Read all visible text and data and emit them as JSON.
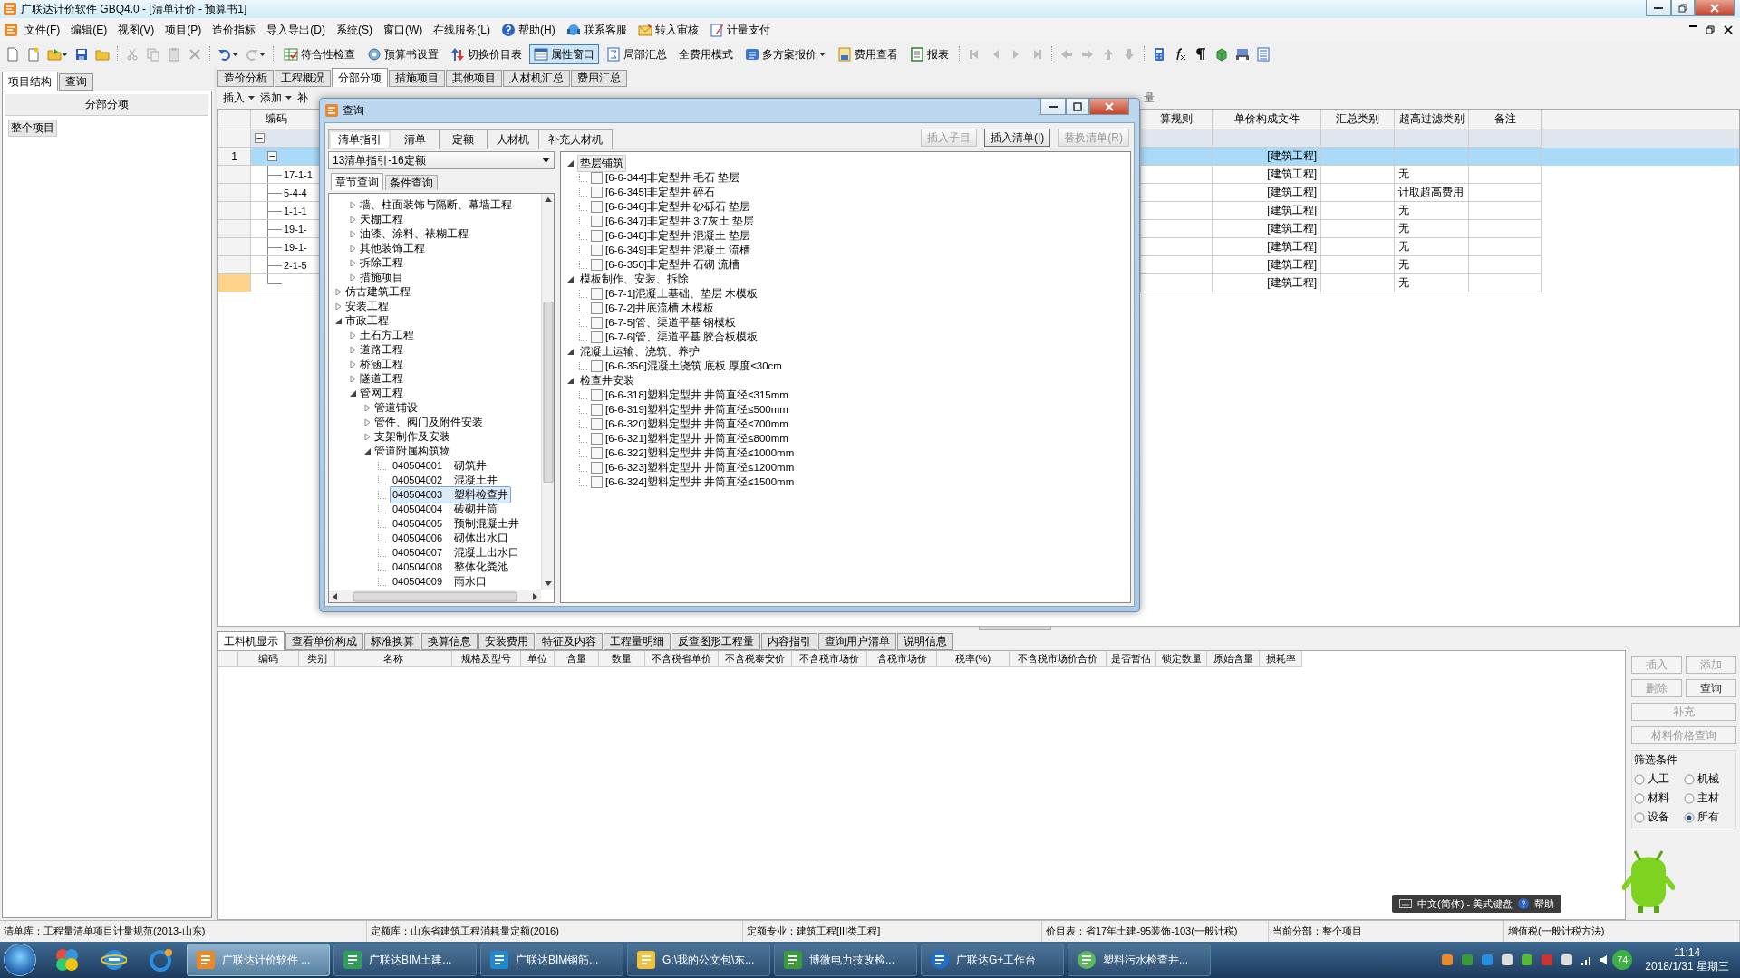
{
  "window": {
    "title": "广联达计价软件 GBQ4.0 - [清单计价 - 预算书1]"
  },
  "menu": [
    {
      "label": "文件(F)",
      "kind": "plain"
    },
    {
      "label": "编辑(E)",
      "kind": "plain"
    },
    {
      "label": "视图(V)",
      "kind": "plain"
    },
    {
      "label": "项目(P)",
      "kind": "plain"
    },
    {
      "label": "造价指标",
      "kind": "plain"
    },
    {
      "label": "导入导出(D)",
      "kind": "plain"
    },
    {
      "label": "系统(S)",
      "kind": "plain"
    },
    {
      "label": "窗口(W)",
      "kind": "plain"
    },
    {
      "label": "在线服务(L)",
      "kind": "plain"
    },
    {
      "label": "帮助(H)",
      "kind": "help"
    },
    {
      "label": "联系客服",
      "kind": "service"
    },
    {
      "label": "转入审核",
      "kind": "review"
    },
    {
      "label": "计量支付",
      "kind": "payment"
    }
  ],
  "toolbar": [
    {
      "label": "符合性检查",
      "kind": "check",
      "pressed": false,
      "dropdown": false
    },
    {
      "label": "预算书设置",
      "kind": "gear",
      "pressed": false,
      "dropdown": false
    },
    {
      "label": "切换价目表",
      "kind": "swap",
      "pressed": false,
      "dropdown": false
    },
    {
      "label": "属性窗口",
      "kind": "window",
      "pressed": true,
      "dropdown": false
    },
    {
      "label": "局部汇总",
      "kind": "sum",
      "pressed": false,
      "dropdown": false
    },
    {
      "label": "全费用模式",
      "kind": "plain",
      "pressed": false,
      "dropdown": false
    },
    {
      "label": "多方案报价",
      "kind": "multi",
      "pressed": false,
      "dropdown": true
    },
    {
      "label": "费用查看",
      "kind": "money",
      "pressed": false,
      "dropdown": false
    },
    {
      "label": "报表",
      "kind": "report",
      "pressed": false,
      "dropdown": false
    }
  ],
  "left_panel": {
    "tabs": [
      {
        "label": "项目结构",
        "selected": true
      },
      {
        "label": "查询",
        "selected": false
      }
    ],
    "header": "分部分项",
    "items": [
      {
        "label": "整个项目",
        "selected": true
      }
    ]
  },
  "doc_tabs": [
    {
      "label": "造价分析",
      "selected": false
    },
    {
      "label": "工程概况",
      "selected": false
    },
    {
      "label": "分部分项",
      "selected": true
    },
    {
      "label": "措施项目",
      "selected": false
    },
    {
      "label": "其他项目",
      "selected": false
    },
    {
      "label": "人材机汇总",
      "selected": false
    },
    {
      "label": "费用汇总",
      "selected": false
    }
  ],
  "sub_toolbar": [
    {
      "label": "插入",
      "dropdown": true
    },
    {
      "label": "添加",
      "dropdown": true
    },
    {
      "label": "补",
      "dropdown": false
    }
  ],
  "sub_toolbar_right": "量",
  "main_grid": {
    "columns": [
      "编码",
      "算规则",
      "单价构成文件",
      "汇总类别",
      "超高过滤类别",
      "备注"
    ],
    "rows": [
      {
        "kind": "filter",
        "expanded": true,
        "selected": false,
        "current": false
      },
      {
        "kind": "section",
        "number": "1",
        "expanded": true,
        "selected": true,
        "current": false,
        "unit_file": "[建筑工程]"
      },
      {
        "kind": "item",
        "code": "17-1-1",
        "selected": false,
        "current": false,
        "unit_file": "[建筑工程]",
        "height_filter": "无"
      },
      {
        "kind": "item",
        "code": "5-4-4",
        "selected": false,
        "current": false,
        "unit_file": "[建筑工程]",
        "height_filter": "计取超高费用"
      },
      {
        "kind": "item",
        "code": "1-1-1",
        "selected": false,
        "current": false,
        "unit_file": "[建筑工程]",
        "height_filter": "无"
      },
      {
        "kind": "item",
        "code": "19-1-",
        "selected": false,
        "current": false,
        "unit_file": "[建筑工程]",
        "height_filter": "无"
      },
      {
        "kind": "item",
        "code": "19-1-",
        "selected": false,
        "current": false,
        "unit_file": "[建筑工程]",
        "height_filter": "无"
      },
      {
        "kind": "item",
        "code": "2-1-5",
        "selected": false,
        "current": false,
        "unit_file": "[建筑工程]",
        "height_filter": "无"
      },
      {
        "kind": "item",
        "selected": false,
        "current": true,
        "unit_file": "[建筑工程]",
        "height_filter": "无"
      }
    ]
  },
  "dialog": {
    "title": "查询",
    "tabs": [
      {
        "label": "清单指引",
        "selected": true
      },
      {
        "label": "清单",
        "selected": false
      },
      {
        "label": "定额",
        "selected": false
      },
      {
        "label": "人材机",
        "selected": false
      },
      {
        "label": "补充人材机",
        "selected": false
      }
    ],
    "buttons": [
      {
        "label": "插入子目",
        "disabled": true
      },
      {
        "label": "插入清单(I)",
        "disabled": false
      },
      {
        "label": "替换清单(R)",
        "disabled": true
      }
    ],
    "library": "13清单指引-16定额",
    "query_tabs": [
      {
        "label": "章节查询",
        "selected": true
      },
      {
        "label": "条件查询",
        "selected": false
      }
    ],
    "chapter_tree": [
      {
        "children": [
          {
            "label": "墙、柱面装饰与隔断、幕墙工程",
            "expanded": false
          },
          {
            "label": "天棚工程",
            "expanded": false
          },
          {
            "label": "油漆、涂料、裱糊工程",
            "expanded": false
          },
          {
            "label": "其他装饰工程",
            "expanded": false
          },
          {
            "label": "拆除工程",
            "expanded": false
          },
          {
            "label": "措施项目",
            "expanded": false
          }
        ]
      },
      {
        "label": "仿古建筑工程",
        "expanded": false
      },
      {
        "label": "安装工程",
        "expanded": false
      },
      {
        "label": "市政工程",
        "expanded": true,
        "children": [
          {
            "label": "土石方工程",
            "expanded": false
          },
          {
            "label": "道路工程",
            "expanded": false
          },
          {
            "label": "桥涵工程",
            "expanded": false
          },
          {
            "label": "隧道工程",
            "expanded": false
          },
          {
            "label": "管网工程",
            "expanded": true,
            "children": [
              {
                "label": "管道铺设",
                "expanded": false
              },
              {
                "label": "管件、阀门及附件安装",
                "expanded": false
              },
              {
                "label": "支架制作及安装",
                "expanded": false
              },
              {
                "label": "管道附属构筑物",
                "expanded": true,
                "children": [
                  {
                    "code": "040504001",
                    "label": "砌筑井",
                    "selected": false
                  },
                  {
                    "code": "040504002",
                    "label": "混凝土井",
                    "selected": false
                  },
                  {
                    "code": "040504003",
                    "label": "塑料检查井",
                    "selected": true
                  },
                  {
                    "code": "040504004",
                    "label": "砖砌井筒",
                    "selected": false
                  },
                  {
                    "code": "040504005",
                    "label": "预制混凝土井",
                    "selected": false
                  },
                  {
                    "code": "040504006",
                    "label": "砌体出水口",
                    "selected": false
                  },
                  {
                    "code": "040504007",
                    "label": "混凝土出水口",
                    "selected": false
                  },
                  {
                    "code": "040504008",
                    "label": "整体化粪池",
                    "selected": false
                  },
                  {
                    "code": "040504009",
                    "label": "雨水口",
                    "selected": false
                  }
                ]
              }
            ]
          }
        ]
      }
    ],
    "index_tree": [
      {
        "label": "垫层铺筑",
        "expanded": true,
        "selected": true,
        "children": [
          {
            "label": "[6-6-344]非定型井 毛石 垫层",
            "checked": false
          },
          {
            "label": "[6-6-345]非定型井 碎石",
            "checked": false
          },
          {
            "label": "[6-6-346]非定型井 砂砾石 垫层",
            "checked": false
          },
          {
            "label": "[6-6-347]非定型井 3:7灰土 垫层",
            "checked": false
          },
          {
            "label": "[6-6-348]非定型井 混凝土 垫层",
            "checked": false
          },
          {
            "label": "[6-6-349]非定型井 混凝土 流槽",
            "checked": false
          },
          {
            "label": "[6-6-350]非定型井 石砌 流槽",
            "checked": false
          }
        ]
      },
      {
        "label": "模板制作、安装、拆除",
        "expanded": true,
        "selected": false,
        "children": [
          {
            "label": "[6-7-1]混凝土基础、垫层 木模板",
            "checked": false
          },
          {
            "label": "[6-7-2]井底流槽 木模板",
            "checked": false
          },
          {
            "label": "[6-7-5]管、渠道平基 钢模板",
            "checked": false
          },
          {
            "label": "[6-7-6]管、渠道平基 胶合板模板",
            "checked": false
          }
        ]
      },
      {
        "label": "混凝土运输、浇筑、养护",
        "expanded": true,
        "selected": false,
        "children": [
          {
            "label": "[6-6-356]混凝土浇筑 底板 厚度≤30cm",
            "checked": false
          }
        ]
      },
      {
        "label": "检查井安装",
        "expanded": true,
        "selected": false,
        "children": [
          {
            "label": "[6-6-318]塑料定型井 井筒直径≤315mm",
            "checked": false
          },
          {
            "label": "[6-6-319]塑料定型井 井筒直径≤500mm",
            "checked": false
          },
          {
            "label": "[6-6-320]塑料定型井 井筒直径≤700mm",
            "checked": false
          },
          {
            "label": "[6-6-321]塑料定型井 井筒直径≤800mm",
            "checked": false
          },
          {
            "label": "[6-6-322]塑料定型井 井筒直径≤1000mm",
            "checked": false
          },
          {
            "label": "[6-6-323]塑料定型井 井筒直径≤1200mm",
            "checked": false
          },
          {
            "label": "[6-6-324]塑料定型井 井筒直径≤1500mm",
            "checked": false
          }
        ]
      }
    ]
  },
  "bottom_panel": {
    "tabs": [
      {
        "label": "工料机显示",
        "selected": true
      },
      {
        "label": "查看单价构成",
        "selected": false
      },
      {
        "label": "标准换算",
        "selected": false
      },
      {
        "label": "换算信息",
        "selected": false
      },
      {
        "label": "安装费用",
        "selected": false
      },
      {
        "label": "特征及内容",
        "selected": false
      },
      {
        "label": "工程量明细",
        "selected": false
      },
      {
        "label": "反查图形工程量",
        "selected": false
      },
      {
        "label": "内容指引",
        "selected": false
      },
      {
        "label": "查询用户清单",
        "selected": false
      },
      {
        "label": "说明信息",
        "selected": false
      }
    ],
    "columns": [
      "编码",
      "类别",
      "名称",
      "规格及型号",
      "单位",
      "含量",
      "数量",
      "不含税省单价",
      "不含税泰安价",
      "不含税市场价",
      "含税市场价",
      "税率(%)",
      "不含税市场价合价",
      "是否暂估",
      "锁定数量",
      "原始含量",
      "损耗率"
    ],
    "side_buttons": [
      {
        "label": "插入",
        "disabled": true,
        "wide": false
      },
      {
        "label": "添加",
        "disabled": true,
        "wide": false
      },
      {
        "label": "删除",
        "disabled": true,
        "wide": false
      },
      {
        "label": "查询",
        "disabled": false,
        "wide": false
      },
      {
        "label": "补充",
        "disabled": true,
        "wide": true
      },
      {
        "label": "材料价格查询",
        "disabled": true,
        "wide": true
      }
    ],
    "filter": {
      "title": "筛选条件",
      "options": [
        {
          "label": "人工",
          "selected": false
        },
        {
          "label": "机械",
          "selected": false
        },
        {
          "label": "材料",
          "selected": false
        },
        {
          "label": "主材",
          "selected": false
        },
        {
          "label": "设备",
          "selected": false
        },
        {
          "label": "所有",
          "selected": true
        }
      ]
    }
  },
  "ime_bar": {
    "label": "中文(简体) - 美式键盘",
    "help": "帮助"
  },
  "status_bar": [
    "清单库：工程量清单项目计量规范(2013-山东)",
    "定额库：山东省建筑工程消耗量定额(2016)",
    "定额专业：建筑工程[III类工程]",
    "价目表：省17年土建-95装饰-103(一般计税)",
    "当前分部：整个项目",
    "增值税(一般计税方法)"
  ],
  "taskbar": {
    "tasks": [
      {
        "label": "广联达计价软件 ...",
        "kind": "gbq",
        "selected": true
      },
      {
        "label": "广联达BIM土建...",
        "kind": "bim",
        "selected": false
      },
      {
        "label": "广联达BIM钢筋...",
        "kind": "steel",
        "selected": false
      },
      {
        "label": "G:\\我的公文包\\东...",
        "kind": "folder",
        "selected": false
      },
      {
        "label": "博微电力技改检...",
        "kind": "jg",
        "selected": false
      },
      {
        "label": "广联达G+工作台",
        "kind": "gplus",
        "selected": false
      },
      {
        "label": "塑料污水检查井...",
        "kind": "browser",
        "selected": false
      }
    ],
    "badge": "74",
    "time": "11:14",
    "date": "2018/1/31 星期三"
  }
}
